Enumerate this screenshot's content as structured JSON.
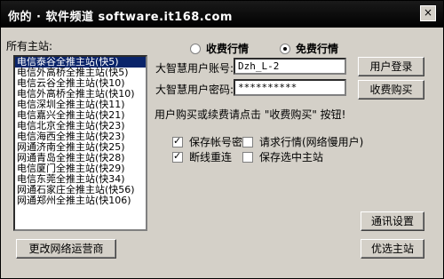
{
  "titlebar": {
    "title": "你的 · 软件频道 software.it168.com",
    "close_label": "×"
  },
  "server_list": {
    "label": "所有主站:",
    "items": [
      "电信泰谷全推主站(快5)",
      "电信外高桥全推主站(快5)",
      "电信云谷全推主站(快10)",
      "电信外高桥全推主站(快10)",
      "电信深圳全推主站(快11)",
      "电信嘉兴全推主站(快21)",
      "电信北京全推主站(快23)",
      "电信海西全推主站(快23)",
      "网通济南全推主站(快25)",
      "网通青岛全推主站(快28)",
      "电信厦门全推主站(快29)",
      "电信东莞全推主站(快34)",
      "网通石家庄全推主站(快56)",
      "网通郑州全推主站(快106)"
    ],
    "selected_index": 0
  },
  "mode": {
    "paid_label": "收费行情",
    "free_label": "免费行情",
    "selected": "free"
  },
  "login": {
    "account_label": "大智慧用户账号:",
    "account_value": "Dzh_L-2",
    "password_label": "大智慧用户密码:",
    "password_value": "**********",
    "login_button": "用户登录",
    "buy_button": "收费购买"
  },
  "hint": "用户购买或续费请点击 \"收费购买\" 按钮!",
  "options": {
    "save_account": {
      "label": "保存帐号密码",
      "checked": true
    },
    "request_quotes": {
      "label": "请求行情(网络慢用户)",
      "checked": false
    },
    "reconnect": {
      "label": "断线重连",
      "checked": true
    },
    "save_selected": {
      "label": "保存选中主站",
      "checked": false
    }
  },
  "buttons": {
    "comm_settings": "通讯设置",
    "change_isp": "更改网络运营商",
    "optimal_server": "优选主站"
  }
}
